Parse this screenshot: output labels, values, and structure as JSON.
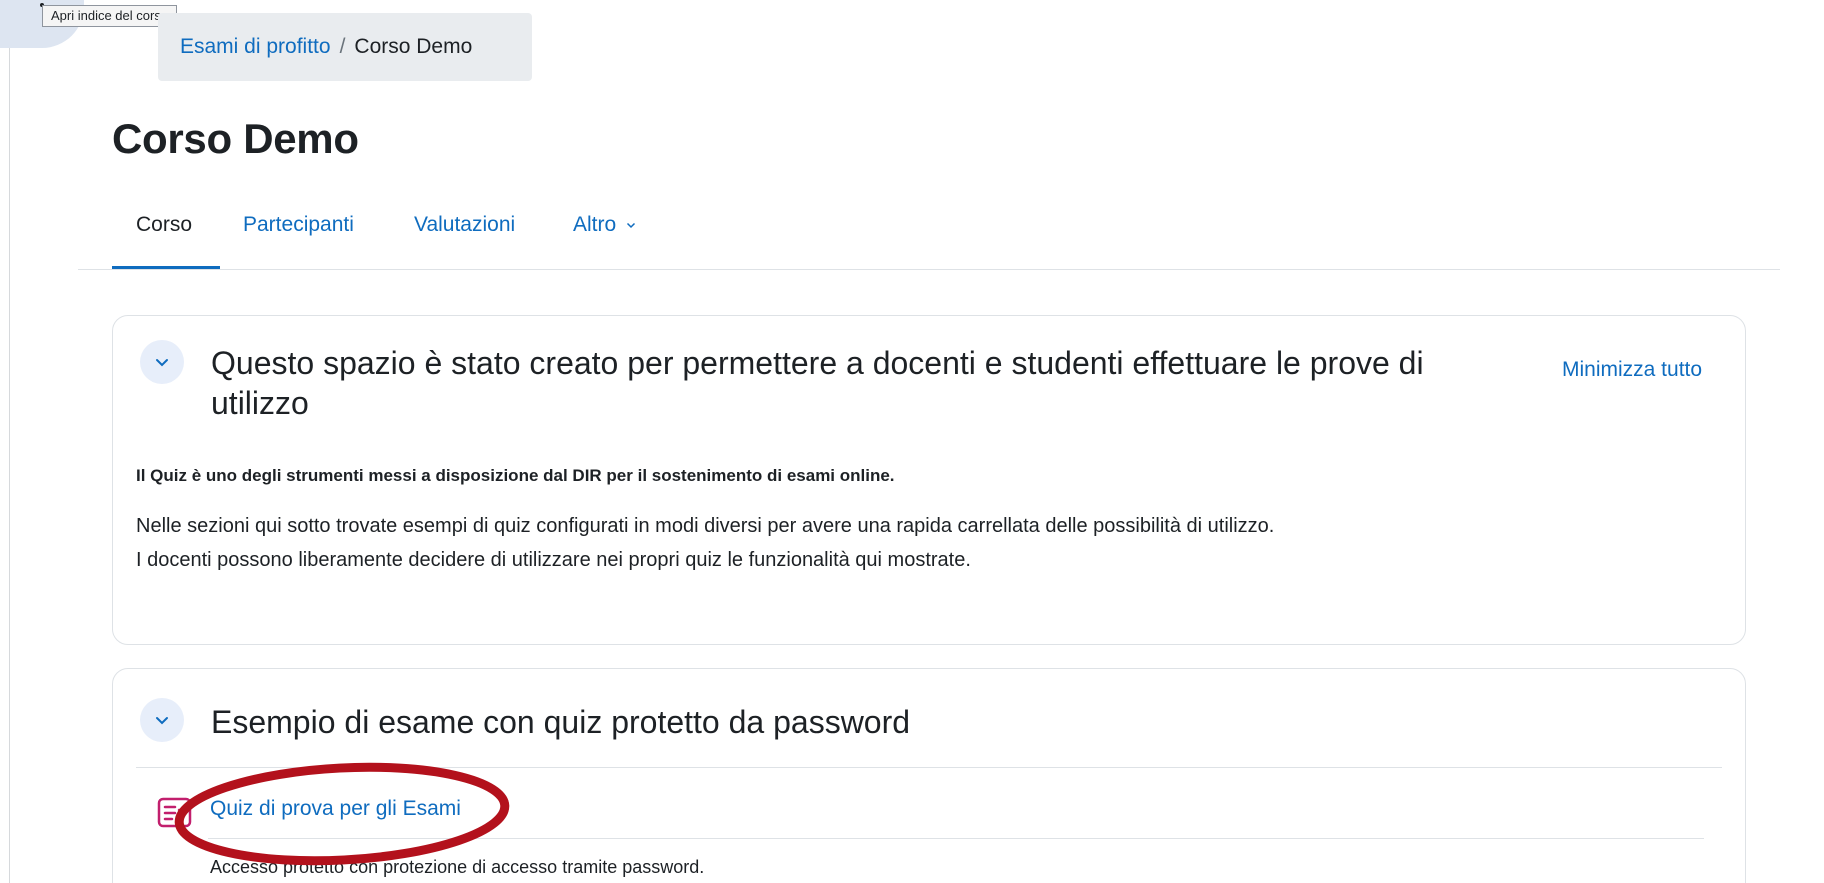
{
  "tooltip": {
    "text": "Apri indice del corso"
  },
  "breadcrumb": {
    "parent": "Esami di profitto",
    "separator": "/",
    "current": "Corso Demo"
  },
  "page": {
    "title": "Corso Demo"
  },
  "tabs": [
    {
      "label": "Corso",
      "active": true
    },
    {
      "label": "Partecipanti",
      "active": false
    },
    {
      "label": "Valutazioni",
      "active": false
    },
    {
      "label": "Altro",
      "active": false,
      "dropdown": true
    }
  ],
  "sections": [
    {
      "title_line1": "Questo spazio è stato creato per permettere a docenti e studenti effettuare le prove di",
      "title_line2": "utilizzo",
      "collapse_all_label": "Minimizza tutto",
      "summary": {
        "bold": "Il Quiz è uno degli strumenti messi a disposizione dal DIR per il sostenimento di esami online.",
        "line1": "Nelle sezioni qui sotto trovate esempi di quiz configurati in modi diversi per avere una rapida carrellata delle possibilità di utilizzo.",
        "line2": "I docenti possono liberamente decidere di utilizzare nei propri quiz le funzionalità qui mostrate."
      }
    },
    {
      "title": "Esempio di esame con quiz protetto da password",
      "activity": {
        "name": "Quiz di prova per gli Esami",
        "icon": "quiz-icon",
        "description": "Accesso protetto con protezione di accesso tramite password."
      }
    }
  ],
  "colors": {
    "link": "#0f6cbf",
    "text": "#1d2125",
    "breadcrumb_bg": "#e9ecef",
    "toggle_bg": "#e7eefa",
    "quiz_icon": "#c21f6d",
    "annotation": "#b3111c"
  }
}
